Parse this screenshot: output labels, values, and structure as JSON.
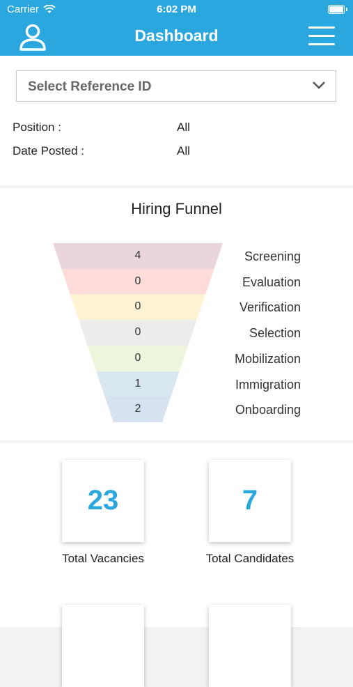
{
  "status_bar": {
    "carrier": "Carrier",
    "time": "6:02 PM"
  },
  "header": {
    "title": "Dashboard",
    "profile_icon": "user-icon",
    "menu_icon": "hamburger-menu-icon"
  },
  "filter": {
    "select_placeholder": "Select Reference ID",
    "rows": [
      {
        "label": "Position :",
        "value": "All"
      },
      {
        "label": "Date Posted :",
        "value": "All"
      }
    ]
  },
  "funnel": {
    "title": "Hiring Funnel",
    "stages": [
      {
        "name": "Screening",
        "count": "4",
        "color": "#ead5de"
      },
      {
        "name": "Evaluation",
        "count": "0",
        "color": "#fddbd9"
      },
      {
        "name": "Verification",
        "count": "0",
        "color": "#fdf3d2"
      },
      {
        "name": "Selection",
        "count": "0",
        "color": "#ececea"
      },
      {
        "name": "Mobilization",
        "count": "0",
        "color": "#edf5dc"
      },
      {
        "name": "Immigration",
        "count": "1",
        "color": "#d7e6ef"
      },
      {
        "name": "Onboarding",
        "count": "2",
        "color": "#d6e2ef"
      }
    ]
  },
  "stats": [
    {
      "value": "23",
      "label": "Total Vacancies"
    },
    {
      "value": "7",
      "label": "Total Candidates"
    }
  ],
  "colors": {
    "accent": "#2aa7df"
  }
}
